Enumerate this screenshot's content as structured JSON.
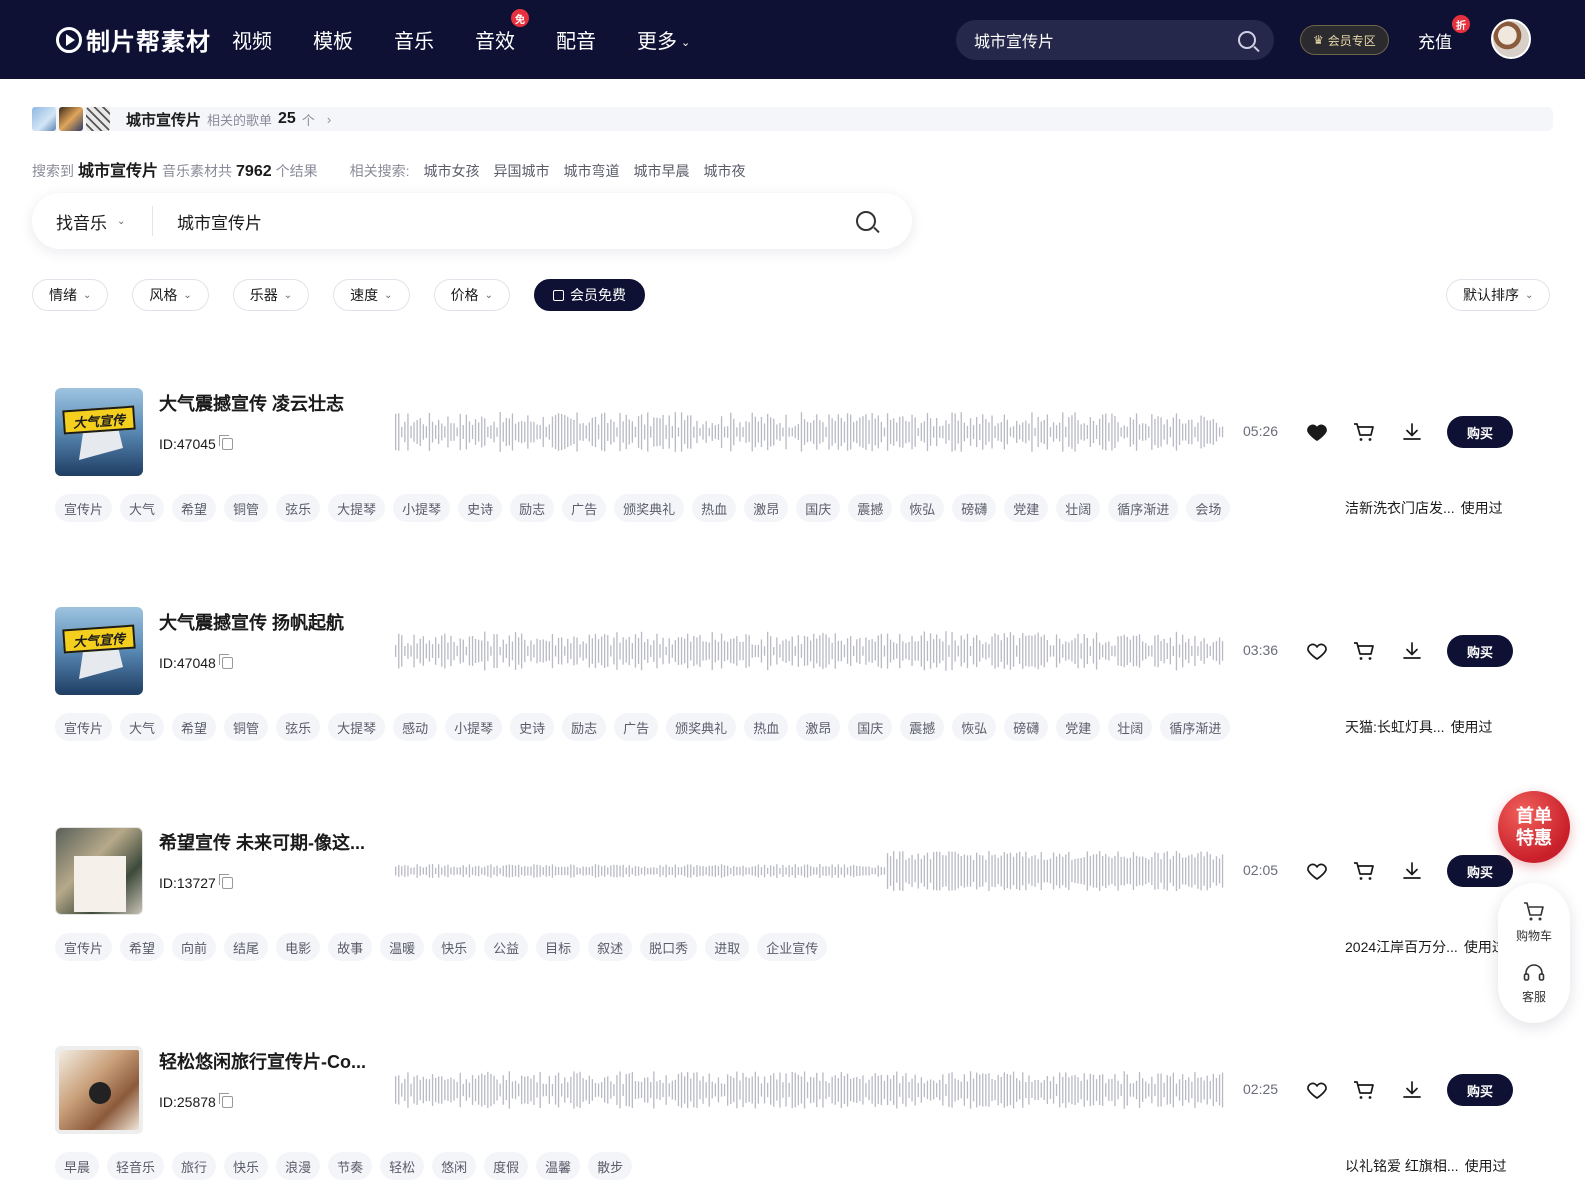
{
  "header": {
    "logo_text": "制片帮素材",
    "nav": [
      {
        "label": "视频"
      },
      {
        "label": "模板"
      },
      {
        "label": "音乐"
      },
      {
        "label": "音效",
        "badge": "免"
      },
      {
        "label": "配音"
      },
      {
        "label": "更多",
        "dropdown": true
      }
    ],
    "search_value": "城市宣传片",
    "vip_label": "会员专区",
    "recharge_label": "充值",
    "recharge_badge": "折"
  },
  "playlist_banner": {
    "keyword": "城市宣传片",
    "prefix": "相关的歌单",
    "count": "25",
    "unit": "个"
  },
  "summary": {
    "prefix": "搜索到",
    "keyword": "城市宣传片",
    "mid": "音乐素材共",
    "count": "7962",
    "suffix": "个结果",
    "related_label": "相关搜索:",
    "related": [
      "城市女孩",
      "异国城市",
      "城市弯道",
      "城市早晨",
      "城市夜"
    ]
  },
  "main_search": {
    "type_label": "找音乐",
    "value": "城市宣传片"
  },
  "filters": {
    "items": [
      "情绪",
      "风格",
      "乐器",
      "速度",
      "价格"
    ],
    "vip_free_label": "会员免费",
    "sort_label": "默认排序"
  },
  "tracks": [
    {
      "title": "大气震撼宣传 凌云壮志",
      "id": "ID:47045",
      "duration": "05:26",
      "liked": true,
      "cover_label": "大气宣传",
      "buy_label": "购买",
      "tags": [
        "宣传片",
        "大气",
        "希望",
        "铜管",
        "弦乐",
        "大提琴",
        "小提琴",
        "史诗",
        "励志",
        "广告",
        "颁奖典礼",
        "热血",
        "激昂",
        "国庆",
        "震撼",
        "恢弘",
        "磅礴",
        "党建",
        "壮阔",
        "循序渐进",
        "会场"
      ],
      "used_by": "洁新洗衣门店发...",
      "used_label": "使用过"
    },
    {
      "title": "大气震撼宣传 扬帆起航",
      "id": "ID:47048",
      "duration": "03:36",
      "liked": false,
      "cover_label": "大气宣传",
      "buy_label": "购买",
      "tags": [
        "宣传片",
        "大气",
        "希望",
        "铜管",
        "弦乐",
        "大提琴",
        "感动",
        "小提琴",
        "史诗",
        "励志",
        "广告",
        "颁奖典礼",
        "热血",
        "激昂",
        "国庆",
        "震撼",
        "恢弘",
        "磅礴",
        "党建",
        "壮阔",
        "循序渐进"
      ],
      "used_by": "天猫:长虹灯具...",
      "used_label": "使用过"
    },
    {
      "title": "希望宣传 未来可期-像这...",
      "id": "ID:13727",
      "duration": "02:05",
      "liked": false,
      "cover_label": "",
      "buy_label": "购买",
      "tags": [
        "宣传片",
        "希望",
        "向前",
        "结尾",
        "电影",
        "故事",
        "温暖",
        "快乐",
        "公益",
        "目标",
        "叙述",
        "脱口秀",
        "进取",
        "企业宣传"
      ],
      "used_by": "2024江岸百万分...",
      "used_label": "使用过"
    },
    {
      "title": "轻松悠闲旅行宣传片-Co...",
      "id": "ID:25878",
      "duration": "02:25",
      "liked": false,
      "cover_label": "",
      "buy_label": "购买",
      "tags": [
        "早晨",
        "轻音乐",
        "旅行",
        "快乐",
        "浪漫",
        "节奏",
        "轻松",
        "悠闲",
        "度假",
        "温馨",
        "散步"
      ],
      "used_by": "以礼铭爱 红旗相...",
      "used_label": "使用过"
    }
  ],
  "floating": {
    "promo_line1": "首单",
    "promo_line2": "特惠",
    "cart_label": "购物车",
    "service_label": "客服"
  }
}
